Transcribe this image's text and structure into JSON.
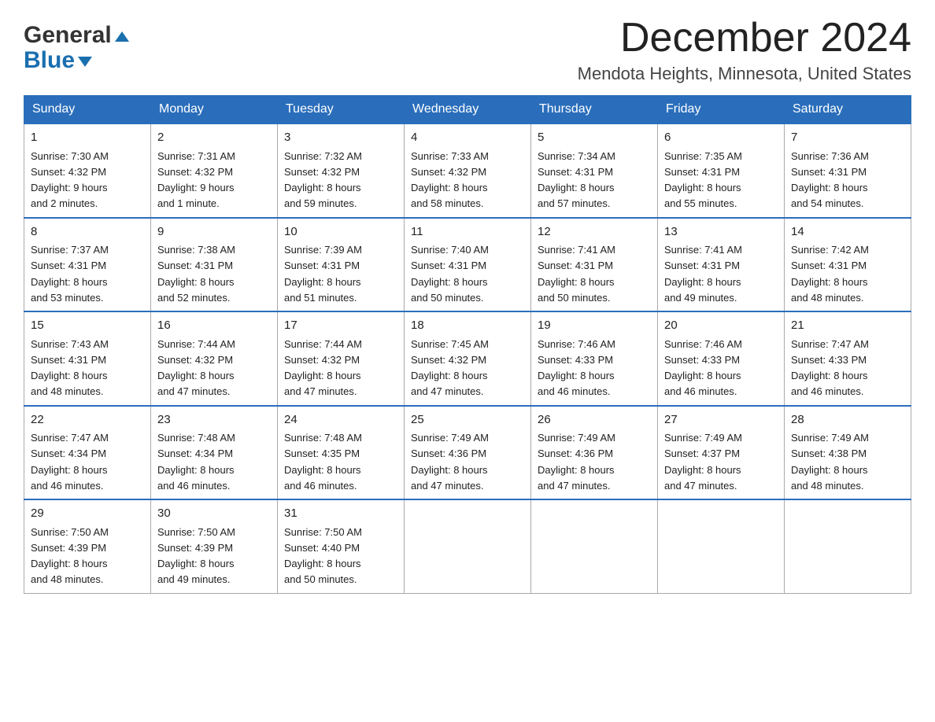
{
  "logo": {
    "general": "General",
    "blue": "Blue",
    "triangle_alt": "logo triangle"
  },
  "title": {
    "month": "December 2024",
    "location": "Mendota Heights, Minnesota, United States"
  },
  "header": {
    "days": [
      "Sunday",
      "Monday",
      "Tuesday",
      "Wednesday",
      "Thursday",
      "Friday",
      "Saturday"
    ]
  },
  "weeks": [
    [
      {
        "day": "1",
        "sunrise": "7:30 AM",
        "sunset": "4:32 PM",
        "daylight": "9 hours and 2 minutes."
      },
      {
        "day": "2",
        "sunrise": "7:31 AM",
        "sunset": "4:32 PM",
        "daylight": "9 hours and 1 minute."
      },
      {
        "day": "3",
        "sunrise": "7:32 AM",
        "sunset": "4:32 PM",
        "daylight": "8 hours and 59 minutes."
      },
      {
        "day": "4",
        "sunrise": "7:33 AM",
        "sunset": "4:32 PM",
        "daylight": "8 hours and 58 minutes."
      },
      {
        "day": "5",
        "sunrise": "7:34 AM",
        "sunset": "4:31 PM",
        "daylight": "8 hours and 57 minutes."
      },
      {
        "day": "6",
        "sunrise": "7:35 AM",
        "sunset": "4:31 PM",
        "daylight": "8 hours and 55 minutes."
      },
      {
        "day": "7",
        "sunrise": "7:36 AM",
        "sunset": "4:31 PM",
        "daylight": "8 hours and 54 minutes."
      }
    ],
    [
      {
        "day": "8",
        "sunrise": "7:37 AM",
        "sunset": "4:31 PM",
        "daylight": "8 hours and 53 minutes."
      },
      {
        "day": "9",
        "sunrise": "7:38 AM",
        "sunset": "4:31 PM",
        "daylight": "8 hours and 52 minutes."
      },
      {
        "day": "10",
        "sunrise": "7:39 AM",
        "sunset": "4:31 PM",
        "daylight": "8 hours and 51 minutes."
      },
      {
        "day": "11",
        "sunrise": "7:40 AM",
        "sunset": "4:31 PM",
        "daylight": "8 hours and 50 minutes."
      },
      {
        "day": "12",
        "sunrise": "7:41 AM",
        "sunset": "4:31 PM",
        "daylight": "8 hours and 50 minutes."
      },
      {
        "day": "13",
        "sunrise": "7:41 AM",
        "sunset": "4:31 PM",
        "daylight": "8 hours and 49 minutes."
      },
      {
        "day": "14",
        "sunrise": "7:42 AM",
        "sunset": "4:31 PM",
        "daylight": "8 hours and 48 minutes."
      }
    ],
    [
      {
        "day": "15",
        "sunrise": "7:43 AM",
        "sunset": "4:31 PM",
        "daylight": "8 hours and 48 minutes."
      },
      {
        "day": "16",
        "sunrise": "7:44 AM",
        "sunset": "4:32 PM",
        "daylight": "8 hours and 47 minutes."
      },
      {
        "day": "17",
        "sunrise": "7:44 AM",
        "sunset": "4:32 PM",
        "daylight": "8 hours and 47 minutes."
      },
      {
        "day": "18",
        "sunrise": "7:45 AM",
        "sunset": "4:32 PM",
        "daylight": "8 hours and 47 minutes."
      },
      {
        "day": "19",
        "sunrise": "7:46 AM",
        "sunset": "4:33 PM",
        "daylight": "8 hours and 46 minutes."
      },
      {
        "day": "20",
        "sunrise": "7:46 AM",
        "sunset": "4:33 PM",
        "daylight": "8 hours and 46 minutes."
      },
      {
        "day": "21",
        "sunrise": "7:47 AM",
        "sunset": "4:33 PM",
        "daylight": "8 hours and 46 minutes."
      }
    ],
    [
      {
        "day": "22",
        "sunrise": "7:47 AM",
        "sunset": "4:34 PM",
        "daylight": "8 hours and 46 minutes."
      },
      {
        "day": "23",
        "sunrise": "7:48 AM",
        "sunset": "4:34 PM",
        "daylight": "8 hours and 46 minutes."
      },
      {
        "day": "24",
        "sunrise": "7:48 AM",
        "sunset": "4:35 PM",
        "daylight": "8 hours and 46 minutes."
      },
      {
        "day": "25",
        "sunrise": "7:49 AM",
        "sunset": "4:36 PM",
        "daylight": "8 hours and 47 minutes."
      },
      {
        "day": "26",
        "sunrise": "7:49 AM",
        "sunset": "4:36 PM",
        "daylight": "8 hours and 47 minutes."
      },
      {
        "day": "27",
        "sunrise": "7:49 AM",
        "sunset": "4:37 PM",
        "daylight": "8 hours and 47 minutes."
      },
      {
        "day": "28",
        "sunrise": "7:49 AM",
        "sunset": "4:38 PM",
        "daylight": "8 hours and 48 minutes."
      }
    ],
    [
      {
        "day": "29",
        "sunrise": "7:50 AM",
        "sunset": "4:39 PM",
        "daylight": "8 hours and 48 minutes."
      },
      {
        "day": "30",
        "sunrise": "7:50 AM",
        "sunset": "4:39 PM",
        "daylight": "8 hours and 49 minutes."
      },
      {
        "day": "31",
        "sunrise": "7:50 AM",
        "sunset": "4:40 PM",
        "daylight": "8 hours and 50 minutes."
      },
      null,
      null,
      null,
      null
    ]
  ],
  "labels": {
    "sunrise": "Sunrise:",
    "sunset": "Sunset:",
    "daylight": "Daylight:"
  }
}
